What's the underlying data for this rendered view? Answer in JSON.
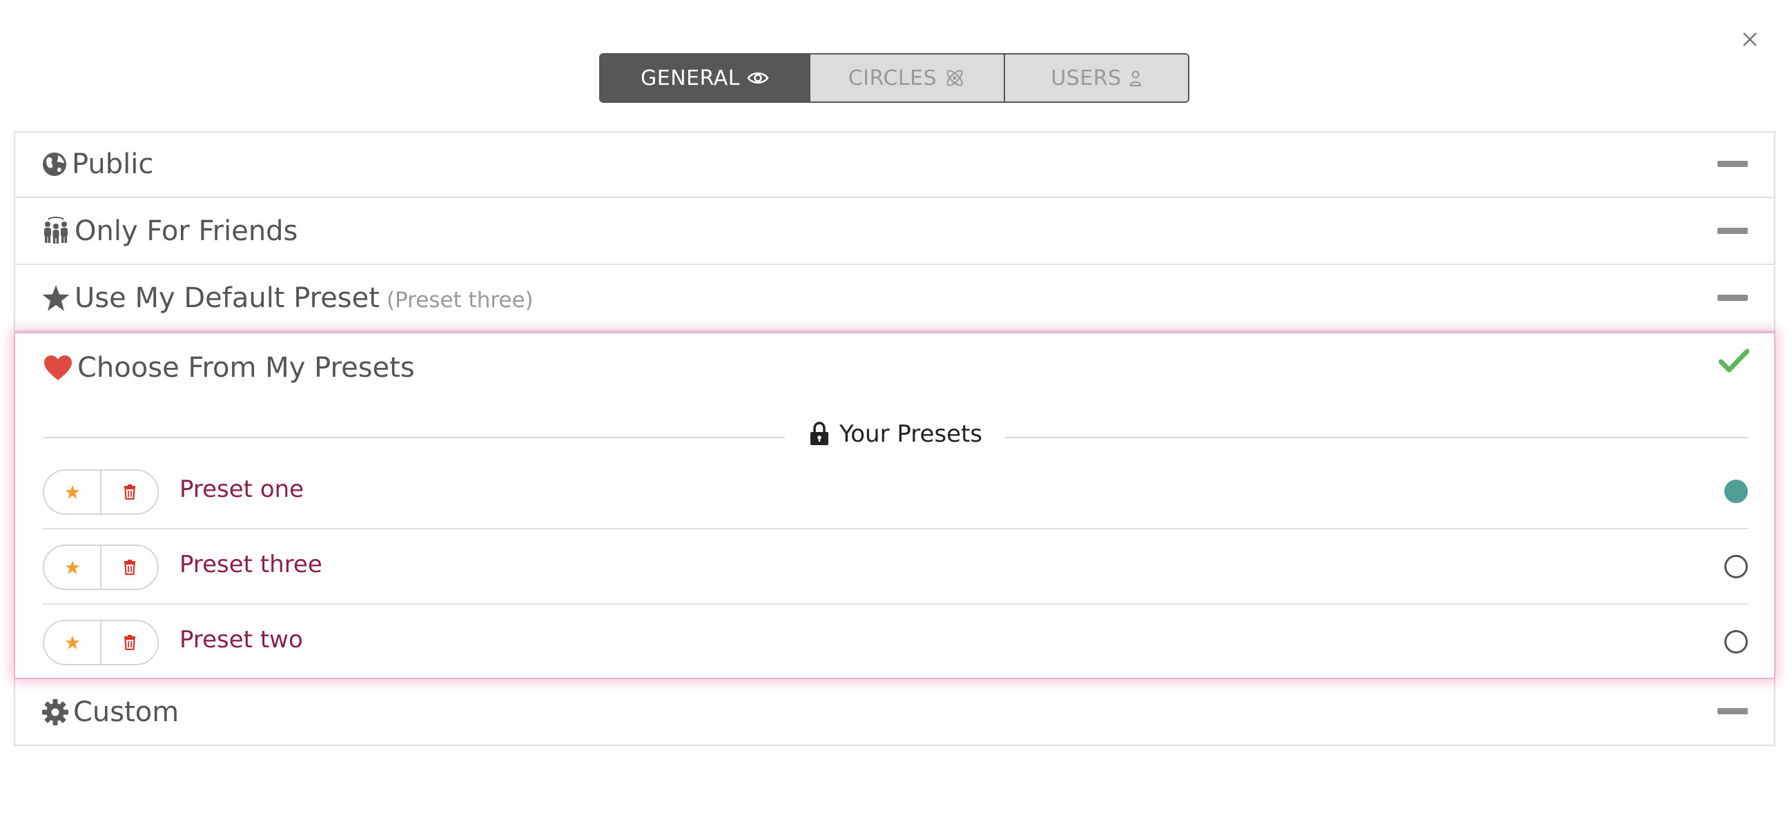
{
  "tabs": [
    {
      "label": "GENERAL",
      "icon": "eye-icon",
      "active": true
    },
    {
      "label": "CIRCLES",
      "icon": "atom-icon",
      "active": false
    },
    {
      "label": "USERS",
      "icon": "user-icon",
      "active": false
    }
  ],
  "options": {
    "public": {
      "label": "Public",
      "icon": "globe-icon"
    },
    "friends": {
      "label": "Only For Friends",
      "icon": "group-icon"
    },
    "default_preset": {
      "label": "Use My Default Preset",
      "sub": "(Preset three)",
      "icon": "star-icon"
    },
    "choose": {
      "label": "Choose From My Presets",
      "icon": "heart-icon",
      "status": "checked"
    },
    "custom": {
      "label": "Custom",
      "icon": "gear-icon"
    }
  },
  "presets_section": {
    "title": "Your Presets",
    "icon": "lock-icon"
  },
  "presets": [
    {
      "name": "Preset one",
      "selected": true
    },
    {
      "name": "Preset three",
      "selected": false
    },
    {
      "name": "Preset two",
      "selected": false
    }
  ],
  "colors": {
    "accent_link": "#8c1f4e",
    "selected_radio": "#4f9f97",
    "heart": "#e04a3f",
    "check": "#5cb85c",
    "star": "#f0a030",
    "trash": "#d9342b"
  }
}
